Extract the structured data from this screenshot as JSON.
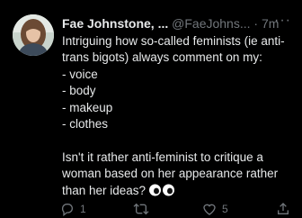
{
  "tweet": {
    "author_name": "Fae Johnstone, ...",
    "handle": "@FaeJohns...",
    "separator": "·",
    "time": "7m",
    "more_label": "···",
    "lines": [
      "Intriguing how so-called feminists (ie anti-",
      "trans bigots) always comment on my:",
      "- voice",
      "- body",
      "- makeup",
      "- clothes"
    ],
    "closing_lines": [
      "Isn't it rather anti-feminist to critique a",
      "woman based on her appearance rather",
      "than her ideas?"
    ],
    "emoji": "eyes-emoji"
  },
  "actions": {
    "reply_count": "1",
    "retweet_count": "",
    "like_count": "5"
  },
  "icons": {
    "reply": "reply-icon",
    "retweet": "retweet-icon",
    "like": "heart-icon",
    "share": "share-icon"
  },
  "colors": {
    "background": "#000000",
    "text": "#e7e9ea",
    "muted": "#71767b"
  }
}
